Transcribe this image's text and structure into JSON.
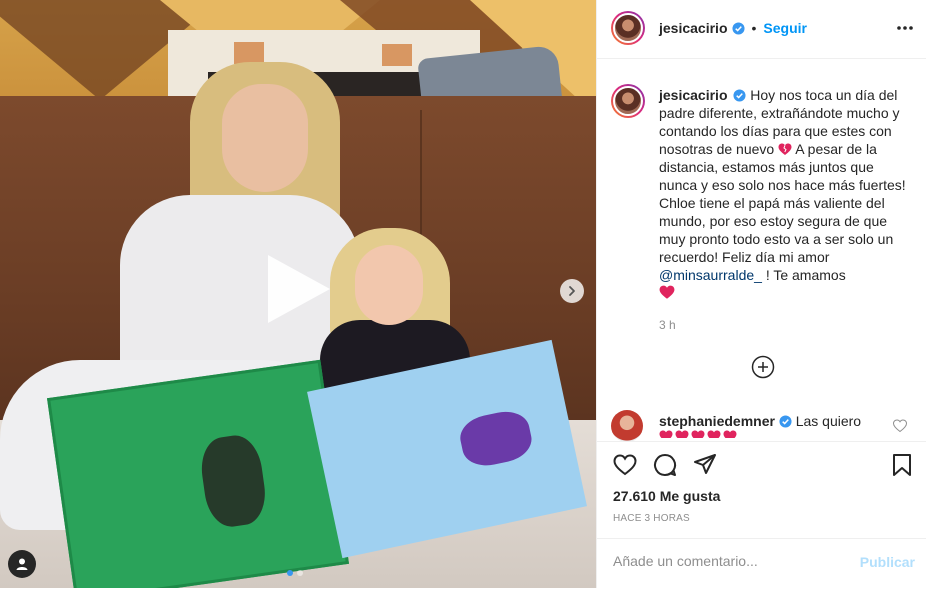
{
  "post": {
    "username": "jesicacirio",
    "verified": true,
    "follow_label": "Seguir",
    "separator": "•",
    "caption": "Hoy nos toca un día del padre diferente, extrañándote mucho y contando los días para que estes con nosotras de nuevo",
    "caption_part2": "A pesar de la distancia, estamos más juntos que nunca y eso solo nos hace más fuertes! Chloe tiene el papá más valiente del mundo, por eso estoy segura de que muy pronto todo esto va a ser solo un recuerdo! Feliz día mi amor",
    "mention": "@minsaurralde_",
    "caption_part3": "! Te amamos",
    "time_ago": "3 h",
    "like_count": "27.610 Me gusta",
    "post_time": "HACE 3 HORAS",
    "carousel_dots": 2,
    "carousel_active": 0
  },
  "comment": {
    "username": "stephaniedemner",
    "verified": true,
    "text": "Las quiero"
  },
  "composer": {
    "placeholder": "Añade un comentario...",
    "publish_label": "Publicar"
  },
  "icons": {
    "more": "more-horizontal-icon",
    "load_more": "add-circle-icon",
    "like": "heart-outline-icon",
    "comment": "speech-bubble-icon",
    "share": "paper-plane-icon",
    "save": "bookmark-icon",
    "play": "play-icon",
    "next": "chevron-right-icon",
    "tags": "user-tag-icon"
  },
  "colors": {
    "link": "#0095f6",
    "mention": "#00376b",
    "heart": "#e0245e",
    "muted": "#8e8e8e",
    "publish_disabled": "#b2dffc"
  }
}
